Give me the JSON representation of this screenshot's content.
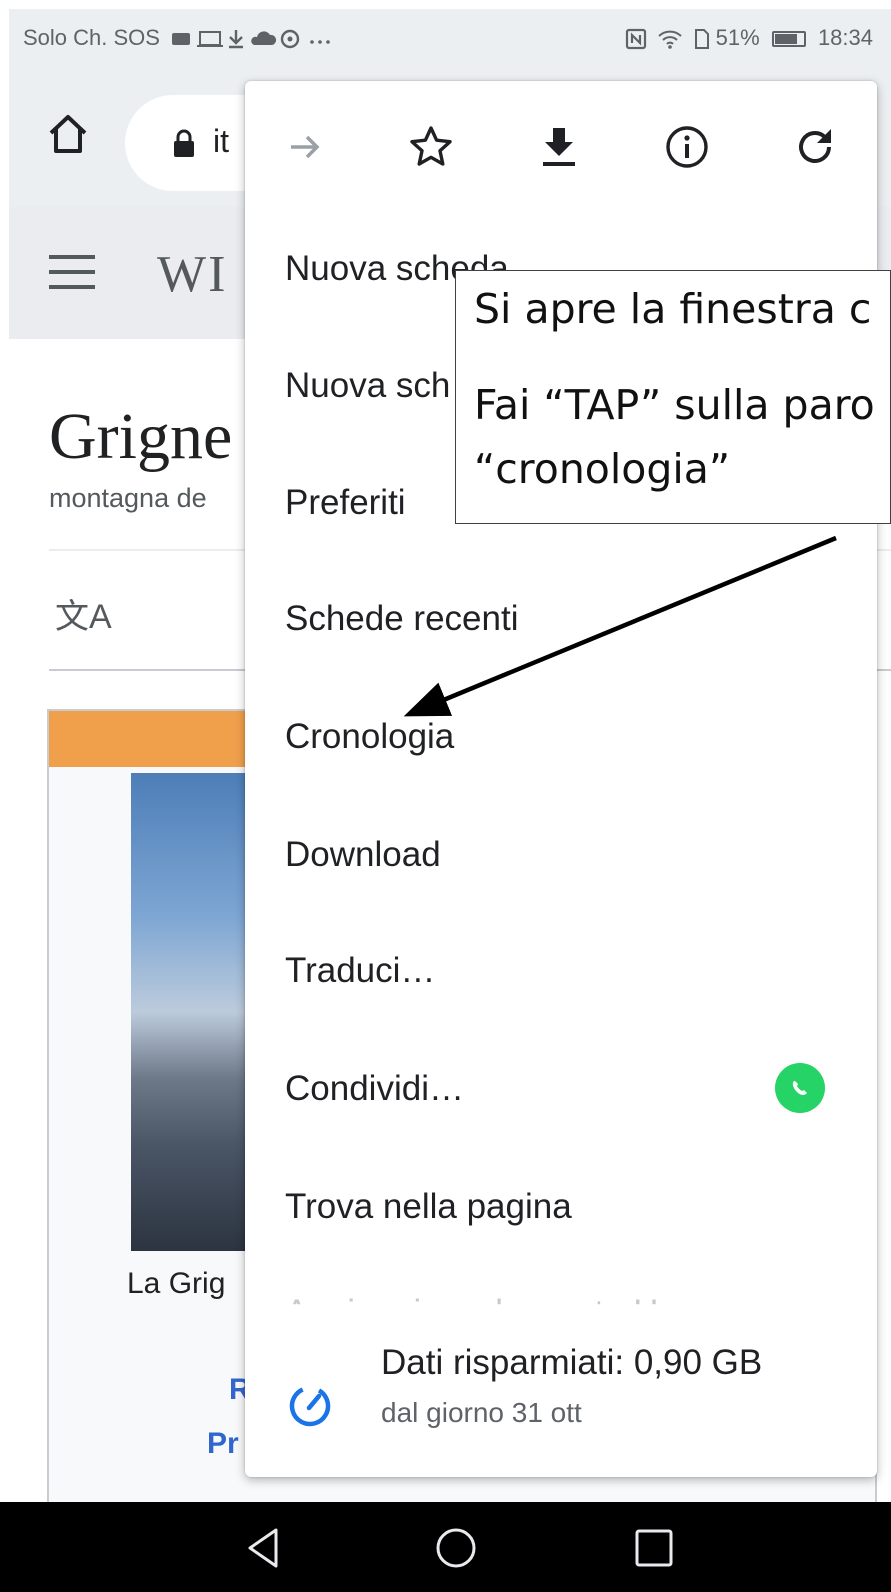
{
  "status_bar": {
    "left_text": "Solo Ch. SOS",
    "battery_percent": "51%",
    "time": "18:34"
  },
  "toolbar": {
    "url_fragment": "it"
  },
  "page": {
    "logo_fragment": "WI",
    "title_fragment": "Grigne",
    "subtitle_fragment": "montagna de",
    "caption_fragment": "La Grig",
    "link1_fragment": "R",
    "link2_fragment": "Pr"
  },
  "menu": {
    "icons": [
      "forward-icon",
      "star-icon",
      "download-icon",
      "info-icon",
      "reload-icon"
    ],
    "items": [
      "Nuova scheda",
      "Nuova sch",
      "Preferiti",
      "Schede recenti",
      "Cronologia",
      "Download",
      "Traduci…",
      "Condividi…",
      "Trova nella pagina"
    ],
    "faded_item": "Aggiungi a schermata Home",
    "data_saver_title": "Dati risparmiati: 0,90 GB",
    "data_saver_sub": "dal giorno 31 ott"
  },
  "callout": {
    "line1": "Si apre la finestra c",
    "line2": "Fai “TAP” sulla paro",
    "line3": "“cronologia”"
  },
  "colors": {
    "accent_blue": "#1a73e8",
    "infobox_band": "#f0a04b",
    "whatsapp": "#25d366"
  }
}
